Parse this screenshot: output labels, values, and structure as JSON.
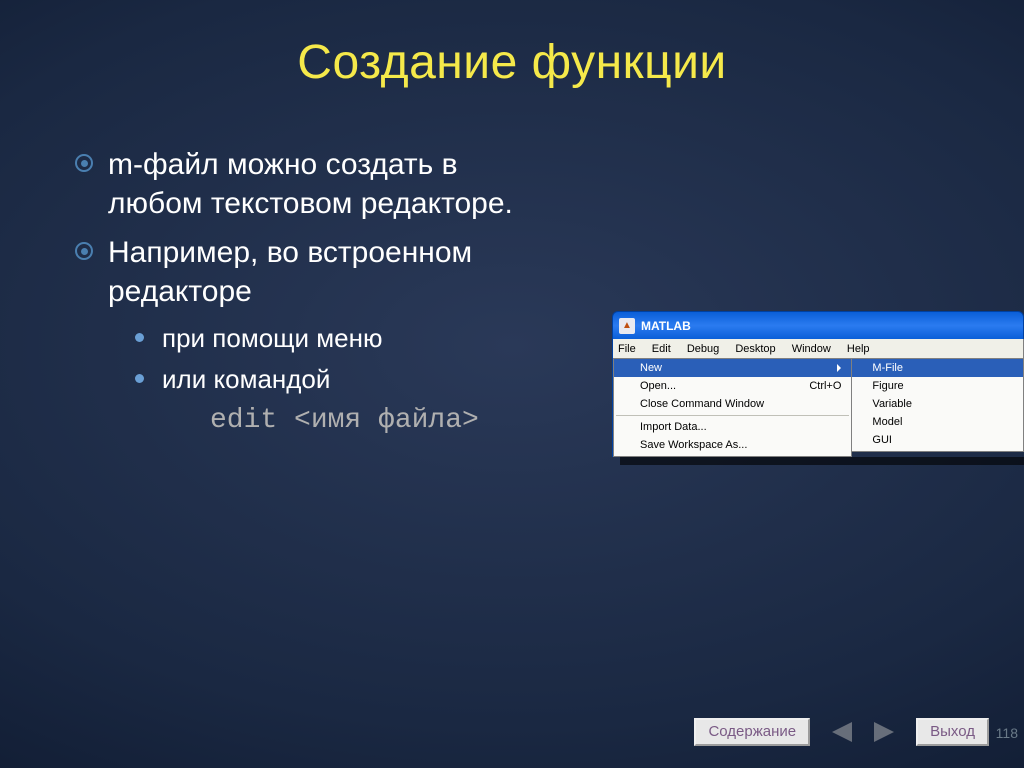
{
  "slide": {
    "title": "Создание функции",
    "bullets": [
      "m-файл можно создать в любом текстовом редакторе.",
      "Например, во встроенном редакторе"
    ],
    "subbullets": [
      "при помощи меню",
      "или командой"
    ],
    "code": "edit <имя файла>"
  },
  "matlab": {
    "app": "MATLAB",
    "menubar": [
      "File",
      "Edit",
      "Debug",
      "Desktop",
      "Window",
      "Help"
    ],
    "file_menu": {
      "new": {
        "label": "New"
      },
      "open": {
        "label": "Open...",
        "shortcut": "Ctrl+O"
      },
      "close_cmd": {
        "label": "Close Command Window"
      },
      "import": {
        "label": "Import Data..."
      },
      "save_ws": {
        "label": "Save Workspace As..."
      }
    },
    "new_submenu": [
      "M-File",
      "Figure",
      "Variable",
      "Model",
      "GUI"
    ]
  },
  "footer": {
    "contents": "Содержание",
    "exit": "Выход",
    "page": "118"
  }
}
